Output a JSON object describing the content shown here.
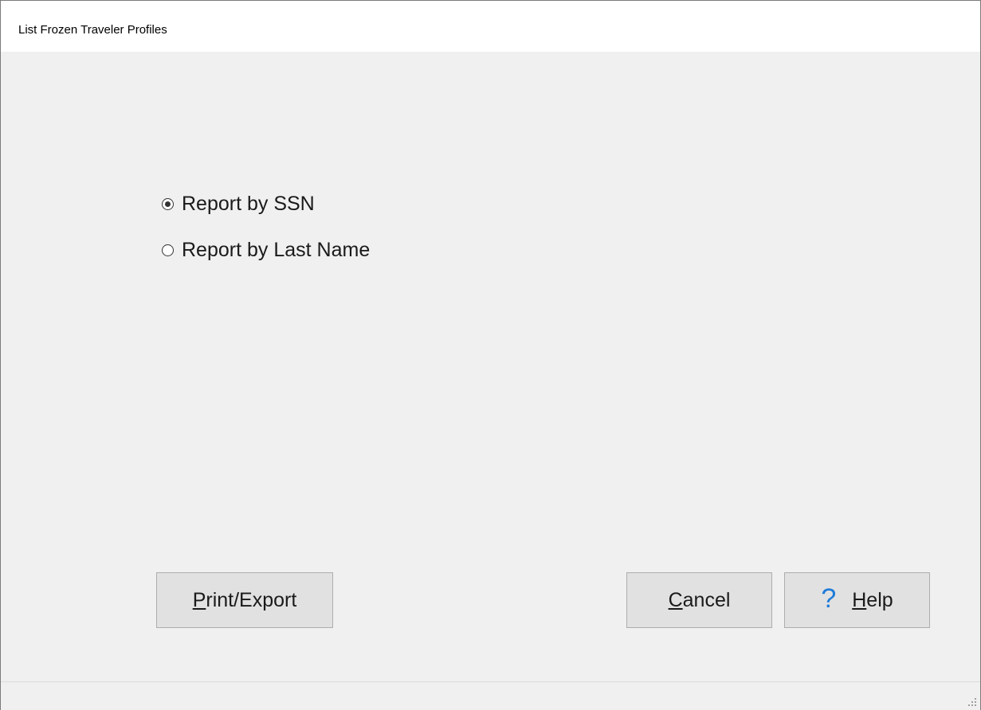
{
  "window": {
    "title": "List Frozen Traveler Profiles"
  },
  "report_options": {
    "items": [
      {
        "label": "Report by SSN",
        "checked": true
      },
      {
        "label": "Report by Last Name",
        "checked": false
      }
    ]
  },
  "buttons": {
    "print_export": {
      "underline": "P",
      "rest": "rint/Export"
    },
    "cancel": {
      "underline": "C",
      "rest": "ancel"
    },
    "help": {
      "underline": "H",
      "rest": "elp",
      "icon": "question-mark-icon"
    }
  },
  "colors": {
    "help_icon": "#1e7bd8",
    "background": "#f0f0f0",
    "button_face": "#e1e1e1"
  }
}
